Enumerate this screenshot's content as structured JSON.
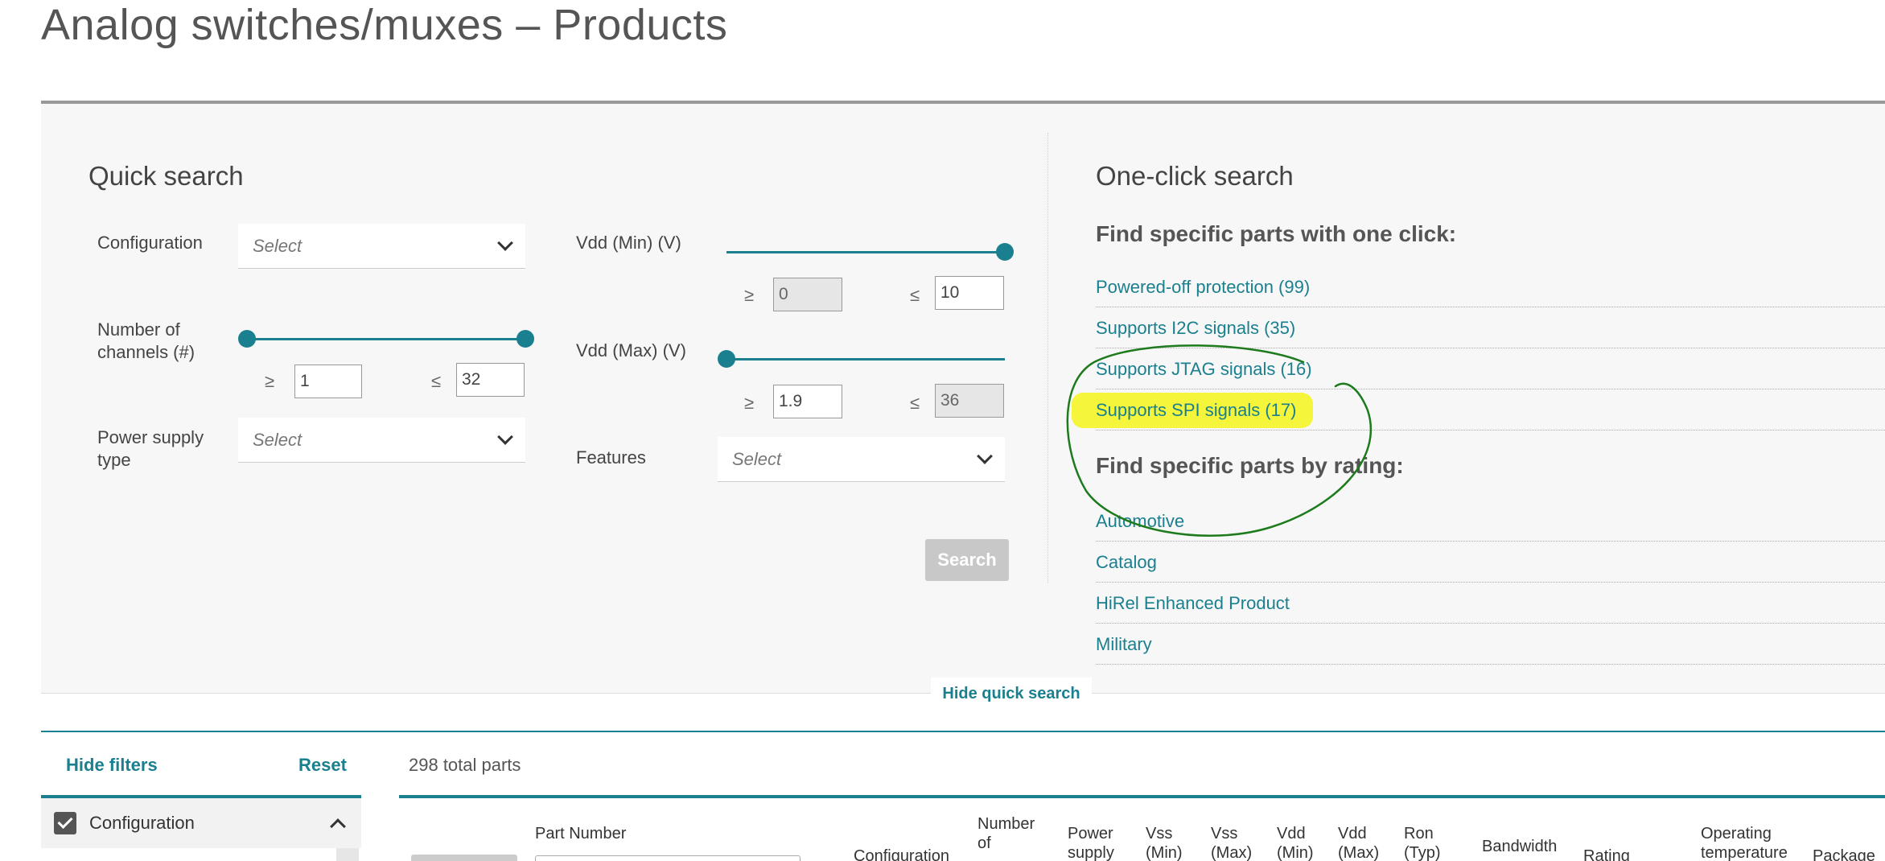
{
  "page": {
    "title": "Analog switches/muxes – Products"
  },
  "quick_search": {
    "heading": "Quick search",
    "configuration": {
      "label": "Configuration",
      "placeholder": "Select"
    },
    "channels": {
      "label_line1": "Number of",
      "label_line2": "channels (#)",
      "ge_symbol": "≥",
      "le_symbol": "≤",
      "min": "1",
      "max": "32"
    },
    "power_supply": {
      "label_line1": "Power supply",
      "label_line2": "type",
      "placeholder": "Select"
    },
    "vdd_min": {
      "label": "Vdd (Min) (V)",
      "ge_symbol": "≥",
      "le_symbol": "≤",
      "min": "0",
      "max": "10"
    },
    "vdd_max": {
      "label": "Vdd (Max) (V)",
      "ge_symbol": "≥",
      "le_symbol": "≤",
      "min": "1.9",
      "max": "36"
    },
    "features": {
      "label": "Features",
      "placeholder": "Select"
    },
    "search_button": "Search",
    "hide_label": "Hide quick search"
  },
  "one_click": {
    "heading": "One-click search",
    "find_one_click": "Find specific parts with one click:",
    "one_click_links": [
      "Powered-off protection (99)",
      "Supports I2C signals (35)",
      "Supports JTAG signals (16)",
      "Supports SPI signals (17)"
    ],
    "find_by_rating": "Find specific parts by rating:",
    "rating_links": [
      "Automotive",
      "Catalog",
      "HiRel Enhanced Product",
      "Military"
    ]
  },
  "filters": {
    "hide_filters": "Hide filters",
    "reset": "Reset",
    "total_parts": "298 total parts",
    "groups": [
      {
        "label": "Configuration",
        "checked": true
      }
    ]
  },
  "table": {
    "columns": [
      "Part Number",
      "Configuration",
      "Number\nof",
      "Power\nsupply",
      "Vss\n(Min)",
      "Vss\n(Max)",
      "Vdd\n(Min)",
      "Vdd\n(Max)",
      "Ron\n(Typ)",
      "Bandwidth",
      "Rating",
      "Operating\ntemperature",
      "Package"
    ]
  },
  "colors": {
    "accent": "#1a7f8e",
    "highlight": "#f5f53b",
    "annotation_ink": "#1d7a1d"
  }
}
